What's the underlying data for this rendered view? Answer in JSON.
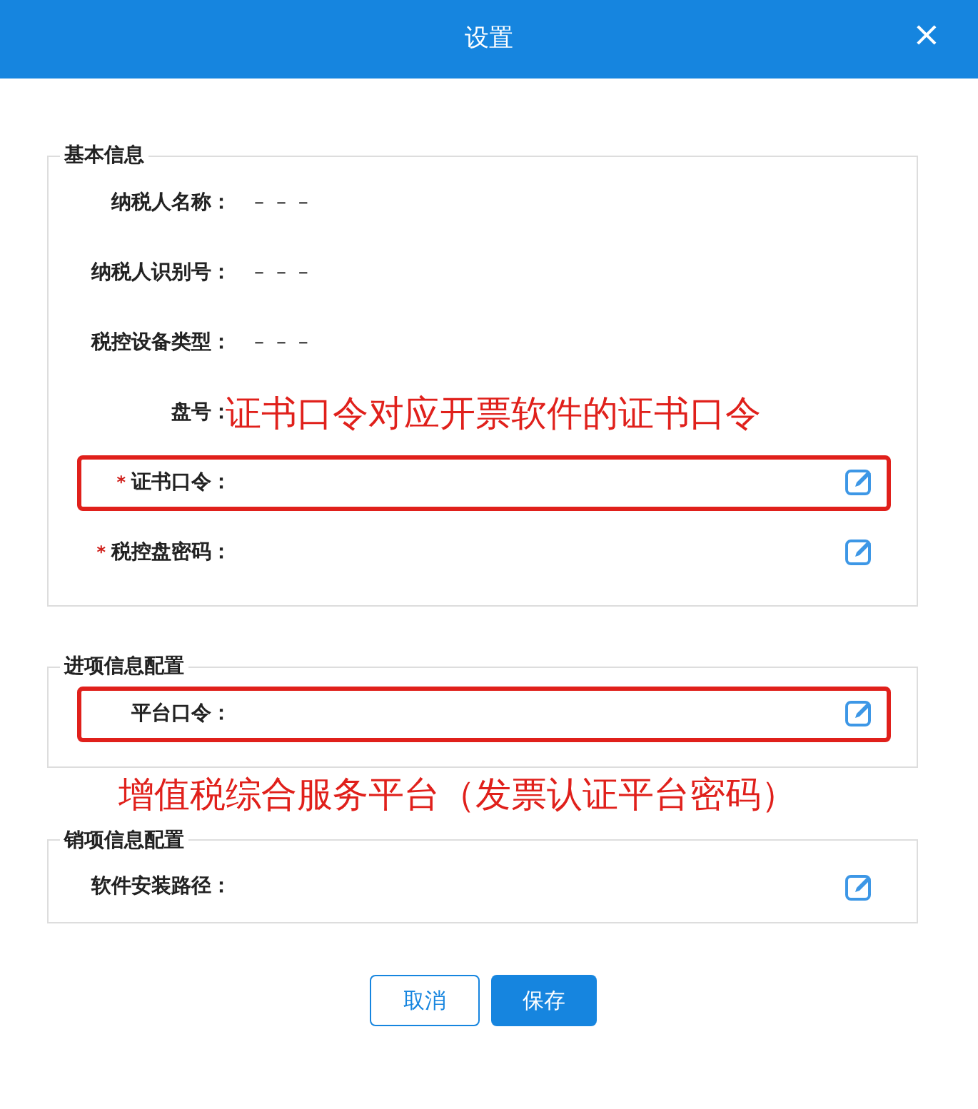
{
  "window": {
    "title": "设置",
    "close": "×"
  },
  "sections": [
    {
      "title": "基本信息",
      "fields": [
        {
          "label": "纳税人名称：",
          "value": "– – –",
          "editable": false,
          "highlighted": false
        },
        {
          "label": "纳税人识别号：",
          "value": "– – –",
          "editable": false,
          "highlighted": false
        },
        {
          "label": "税控设备类型：",
          "value": "– – –",
          "editable": false,
          "highlighted": false
        },
        {
          "label": "盘号：",
          "note": "证书口令对应开票软件的证书口令",
          "editable": false,
          "highlighted": false
        },
        {
          "label": "证书口令：",
          "required_mark": "*",
          "editable": true,
          "highlighted": true
        },
        {
          "label": "税控盘密码：",
          "required_mark": "*",
          "editable": true,
          "highlighted": false
        }
      ]
    },
    {
      "title": "进项信息配置",
      "fields": [
        {
          "label": "平台口令：",
          "editable": true,
          "highlighted": true
        }
      ],
      "note": "增值税综合服务平台（发票认证平台密码）"
    },
    {
      "title": "销项信息配置",
      "fields": [
        {
          "label": "软件安装路径：",
          "editable": true,
          "highlighted": false
        }
      ]
    }
  ],
  "buttons": [
    {
      "label": "取消",
      "kind": "secondary"
    },
    {
      "label": "保存",
      "kind": "primary"
    }
  ]
}
